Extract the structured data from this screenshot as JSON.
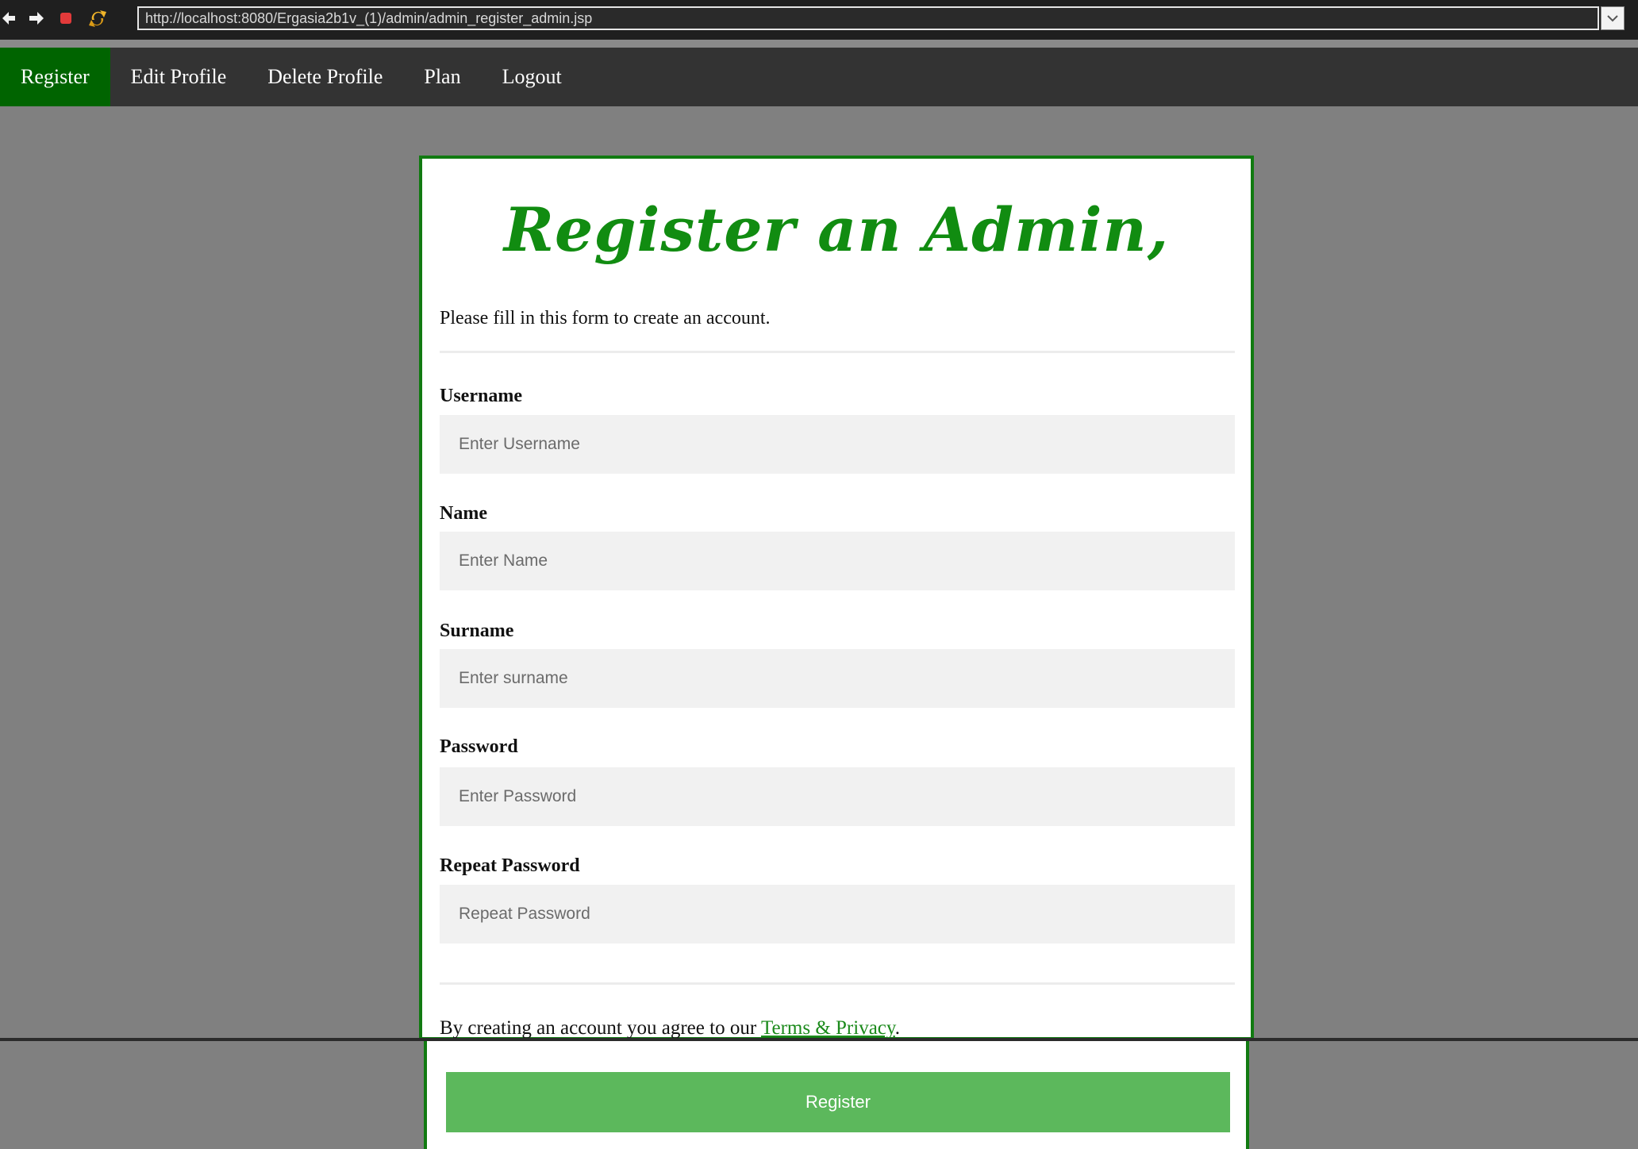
{
  "browser": {
    "url": "http://localhost:8080/Ergasia2b1v_(1)/admin/admin_register_admin.jsp"
  },
  "nav": {
    "items": [
      {
        "label": "Register",
        "active": true
      },
      {
        "label": "Edit Profile",
        "active": false
      },
      {
        "label": "Delete Profile",
        "active": false
      },
      {
        "label": "Plan",
        "active": false
      },
      {
        "label": "Logout",
        "active": false
      }
    ]
  },
  "form": {
    "title": "Register an Admin,",
    "intro": "Please fill in this form to create an account.",
    "fields": [
      {
        "label": "Username",
        "placeholder": "Enter Username"
      },
      {
        "label": "Name",
        "placeholder": "Enter Name"
      },
      {
        "label": "Surname",
        "placeholder": "Enter surname"
      },
      {
        "label": "Password",
        "placeholder": "Enter Password"
      },
      {
        "label": "Repeat Password",
        "placeholder": "Repeat Password"
      }
    ],
    "terms_prefix": "By creating an account you agree to our ",
    "terms_link": "Terms & Privacy",
    "terms_suffix": ".",
    "submit_label": "Register"
  },
  "colors": {
    "nav_bg": "#333333",
    "nav_active": "#006400",
    "accent_green": "#118c11",
    "button_green": "#5cb85c",
    "page_bg": "#808080"
  }
}
